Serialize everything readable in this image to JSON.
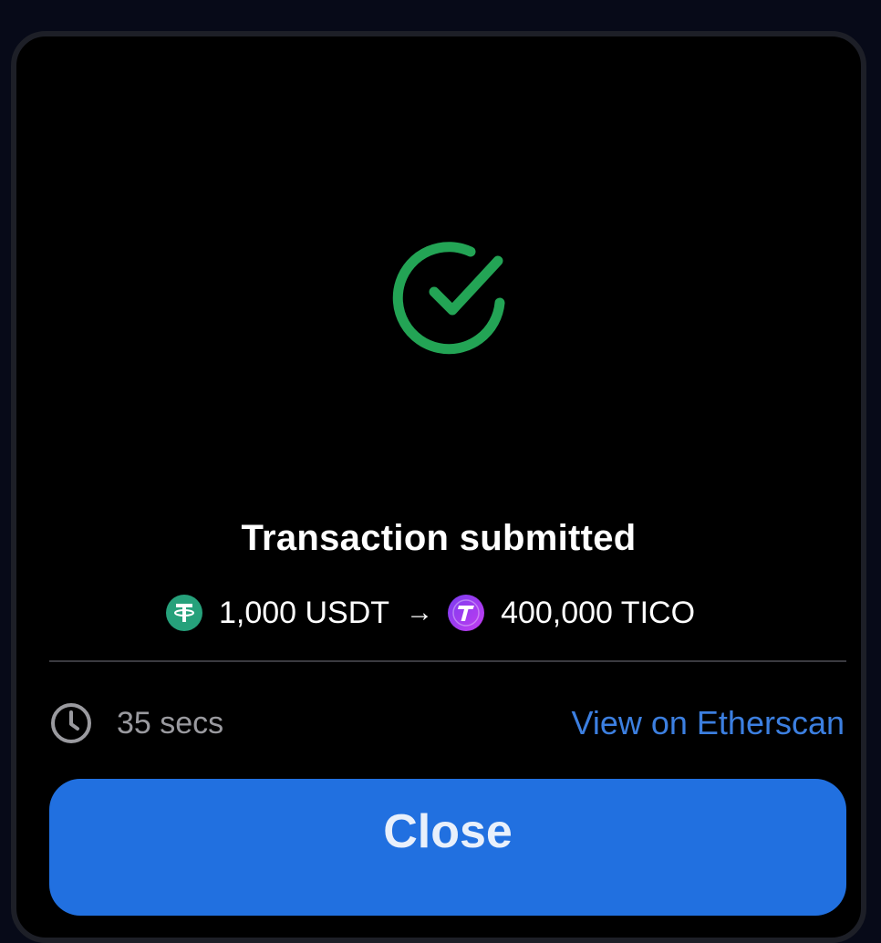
{
  "colors": {
    "success": "#23a455",
    "link": "#3c7fe0",
    "button": "#2170e0",
    "usdt": "#26a17b",
    "tico_start": "#7a3cf0",
    "tico_end": "#c43cf0"
  },
  "status": {
    "icon": "check-circle-icon",
    "title": "Transaction submitted"
  },
  "swap": {
    "from_icon": "usdt-token-icon",
    "from_amount": "1,000 USDT",
    "arrow": "→",
    "to_icon": "tico-token-icon",
    "to_amount": "400,000 TICO"
  },
  "details": {
    "time_icon": "clock-icon",
    "elapsed": "35 secs",
    "explorer_link": "View on Etherscan"
  },
  "actions": {
    "close_label": "Close"
  }
}
